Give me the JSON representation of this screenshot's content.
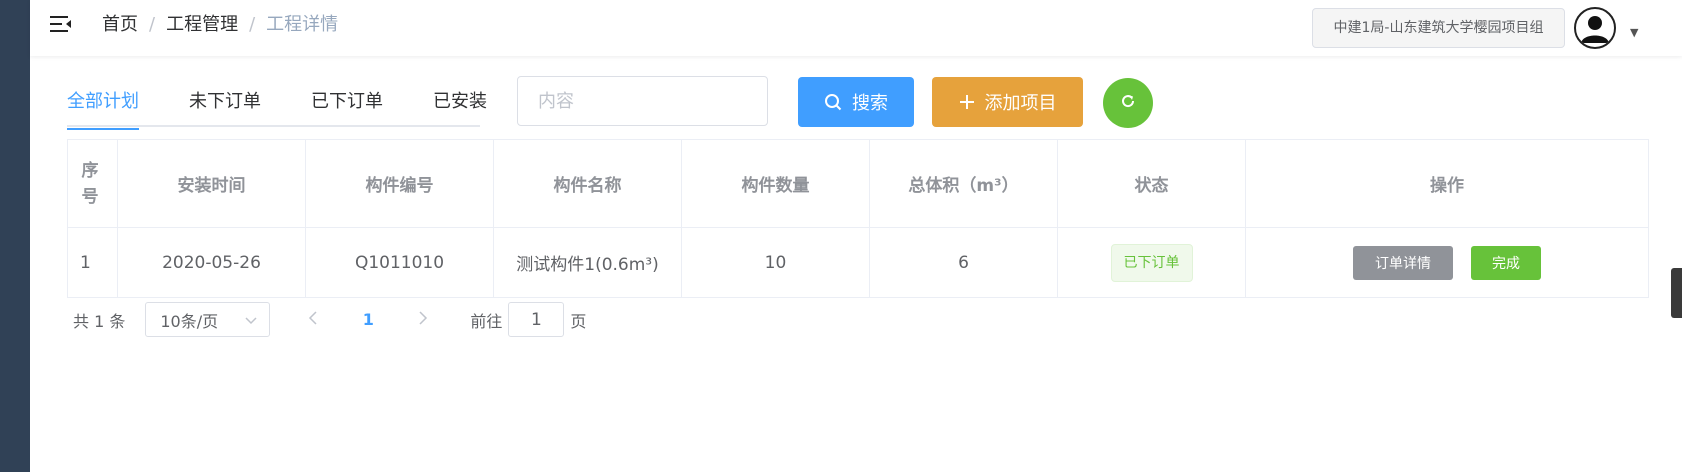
{
  "breadcrumb": [
    "首页",
    "工程管理",
    "工程详情"
  ],
  "project_selector": "中建1局-山东建筑大学樱园项目组",
  "tabs": [
    "全部计划",
    "未下订单",
    "已下订单",
    "已安装"
  ],
  "active_tab": "全部计划",
  "search": {
    "placeholder": "内容",
    "value": ""
  },
  "buttons": {
    "search": "搜索",
    "add": "添加项目"
  },
  "table": {
    "headers": [
      "序号",
      "安装时间",
      "构件编号",
      "构件名称",
      "构件数量",
      "总体积（m³）",
      "状态",
      "操作"
    ],
    "rows": [
      {
        "index": "1",
        "install_date": "2020-05-26",
        "code": "Q1011010",
        "name": "测试构件1(0.6m³)",
        "quantity": "10",
        "volume": "6",
        "status": "已下订单",
        "actions": [
          "订单详情",
          "完成"
        ]
      }
    ]
  },
  "pagination": {
    "total": "共 1 条",
    "page_size": "10条/页",
    "current_page": "1",
    "goto_label": "前往",
    "goto_value": "1",
    "goto_unit": "页"
  },
  "colors": {
    "primary": "#409eff",
    "warning": "#e6a23c",
    "success": "#67c23a",
    "info": "#909399",
    "sidebar": "#304156"
  },
  "icons": [
    "hamburger-icon",
    "avatar-icon",
    "caret-down-icon",
    "search-icon",
    "plus-icon",
    "refresh-icon",
    "arrow-left-icon",
    "arrow-right-icon",
    "chevron-down-icon"
  ]
}
